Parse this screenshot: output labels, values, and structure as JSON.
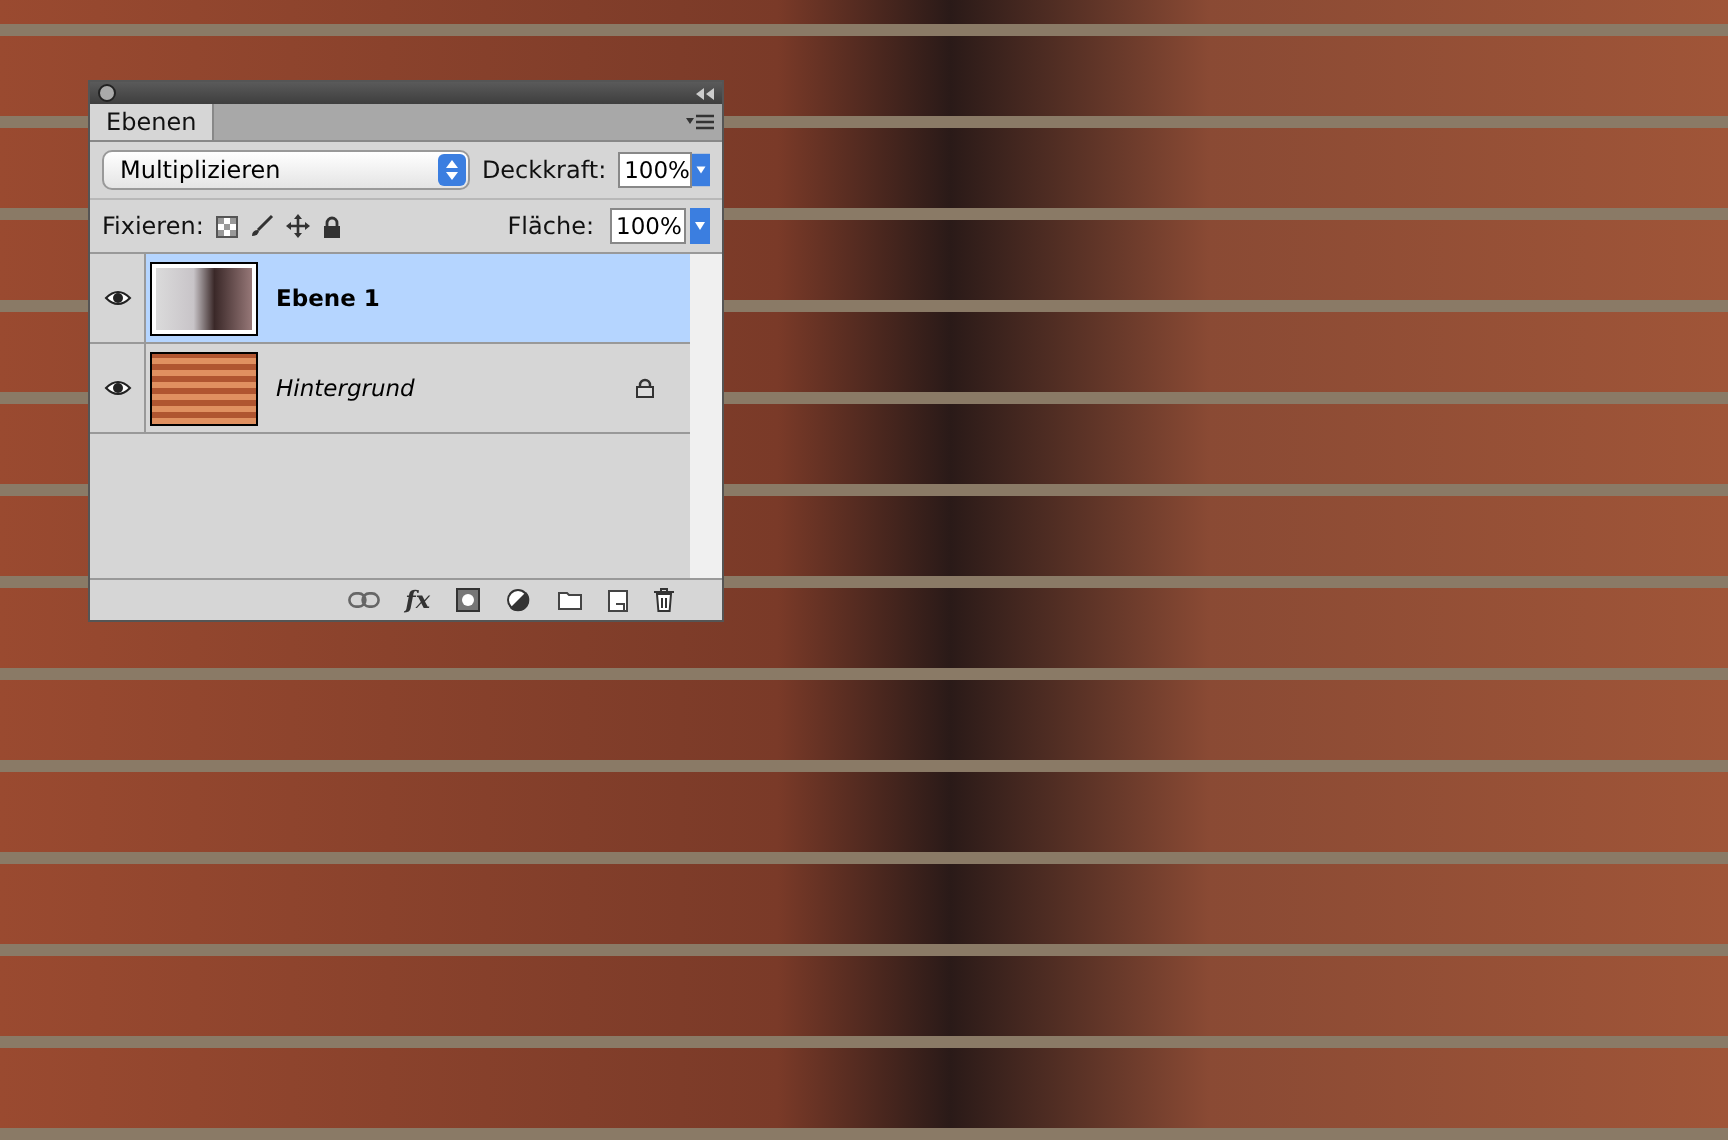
{
  "panel": {
    "tabs": [
      {
        "label": "Ebenen",
        "selected": true
      }
    ],
    "blend_mode": {
      "value": "Multiplizieren"
    },
    "opacity": {
      "label": "Deckkraft:",
      "value": "100%"
    },
    "lock": {
      "label": "Fixieren:"
    },
    "fill": {
      "label": "Fläche:",
      "value": "100%"
    },
    "layers": [
      {
        "name": "Ebene 1",
        "kind": "normal",
        "selected": true,
        "visible": true,
        "locked": false
      },
      {
        "name": "Hintergrund",
        "kind": "background",
        "selected": false,
        "visible": true,
        "locked": true
      }
    ],
    "footer": {
      "fx_label": "fx"
    }
  }
}
